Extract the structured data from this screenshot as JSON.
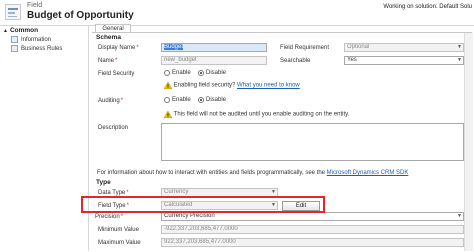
{
  "header": {
    "entity_kind": "Field",
    "title": "Budget of Opportunity",
    "solution_info": "Working on solution: Default Solu"
  },
  "leftnav": {
    "section": "Common",
    "items": [
      {
        "label": "Information"
      },
      {
        "label": "Business Rules"
      }
    ]
  },
  "tabs": [
    {
      "label": "General"
    }
  ],
  "schema": {
    "title": "Schema",
    "display_name": {
      "label": "Display Name",
      "value": "Budget"
    },
    "field_requirement": {
      "label": "Field Requirement",
      "value": "Optional"
    },
    "name": {
      "label": "Name",
      "value": "new_budget"
    },
    "searchable": {
      "label": "Searchable",
      "value": "Yes"
    },
    "field_security": {
      "label": "Field Security",
      "options": [
        "Enable",
        "Disable"
      ],
      "selected": "Disable"
    },
    "field_security_note": {
      "text": "Enabling field security?",
      "link": "What you need to know"
    },
    "auditing": {
      "label": "Auditing",
      "options": [
        "Enable",
        "Disable"
      ],
      "selected": "Disable"
    },
    "auditing_note": "This field will not be audited until you enable auditing on the entity.",
    "description": {
      "label": "Description",
      "value": ""
    },
    "sdk_note": {
      "text": "For information about how to interact with entities and fields programmatically, see the",
      "link": "Microsoft Dynamics CRM SDK"
    }
  },
  "type": {
    "title": "Type",
    "data_type": {
      "label": "Data Type",
      "value": "Currency"
    },
    "field_type": {
      "label": "Field Type",
      "value": "Calculated",
      "edit_label": "Edit"
    },
    "precision": {
      "label": "Precision",
      "value": "Currency Precision"
    },
    "minimum_value": {
      "label": "Minimum Value",
      "value": "-922,337,203,685,477.0000"
    },
    "maximum_value": {
      "label": "Maximum Value",
      "value": "922,337,203,685,477.0000"
    }
  },
  "colors": {
    "highlight": "#e0282e",
    "link": "#1a5fb4",
    "required": "#e21f26"
  }
}
